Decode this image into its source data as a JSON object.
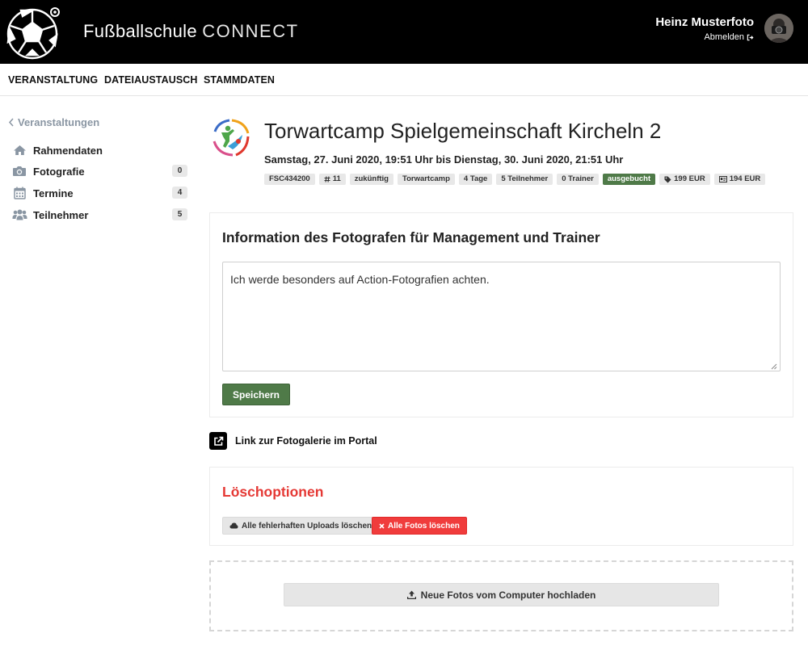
{
  "header": {
    "app_name": "Fußballschule",
    "app_product": "CONNECT",
    "logo_icon": "football-icon",
    "user_name": "Heinz Musterfoto",
    "logout_label": "Abmelden",
    "logout_icon": "sign-out-icon",
    "avatar_icon": "avatar"
  },
  "nav": {
    "items": [
      {
        "label": "VERANSTALTUNG"
      },
      {
        "label": "DATEIAUSTAUSCH"
      },
      {
        "label": "STAMMDATEN"
      }
    ]
  },
  "sidebar": {
    "back_label": "Veranstaltungen",
    "items": [
      {
        "label": "Rahmendaten",
        "icon": "home-icon",
        "badge": null
      },
      {
        "label": "Fotografie",
        "icon": "camera-icon",
        "badge": "0"
      },
      {
        "label": "Termine",
        "icon": "calendar-icon",
        "badge": "4"
      },
      {
        "label": "Teilnehmer",
        "icon": "users-icon",
        "badge": "5"
      }
    ]
  },
  "event": {
    "title": "Torwartcamp Spielgemeinschaft Kircheln 2",
    "date_range": "Samstag, 27. Juni 2020, 19:51 Uhr bis Dienstag, 30. Juni 2020, 21:51 Uhr",
    "tags": [
      {
        "label": "FSC434200",
        "icon": null,
        "variant": "default"
      },
      {
        "label": "11",
        "icon": "hash-icon",
        "variant": "default"
      },
      {
        "label": "zukünftig",
        "icon": null,
        "variant": "default"
      },
      {
        "label": "Torwartcamp",
        "icon": null,
        "variant": "default"
      },
      {
        "label": "4 Tage",
        "icon": null,
        "variant": "default"
      },
      {
        "label": "5 Teilnehmer",
        "icon": null,
        "variant": "default"
      },
      {
        "label": "0 Trainer",
        "icon": null,
        "variant": "default"
      },
      {
        "label": "ausgebucht",
        "icon": null,
        "variant": "success"
      },
      {
        "label": "199 EUR",
        "icon": "tag-icon",
        "variant": "default"
      },
      {
        "label": "194 EUR",
        "icon": "id-card-icon",
        "variant": "default"
      }
    ]
  },
  "photographer_info": {
    "heading": "Information des Fotografen für Management und Trainer",
    "text": "Ich werde besonders auf Action-Fotografien achten.",
    "save_label": "Speichern"
  },
  "gallery_link": {
    "label": "Link zur Fotogalerie im Portal",
    "icon": "external-link-icon"
  },
  "delete_options": {
    "heading": "Löschoptionen",
    "delete_failed_label": "Alle fehlerhaften Uploads löschen",
    "delete_failed_icon": "cloud-icon",
    "delete_all_label": "Alle Fotos löschen",
    "delete_all_icon": "close-icon"
  },
  "upload": {
    "label": "Neue Fotos vom Computer hochladen",
    "icon": "upload-icon"
  },
  "colors": {
    "header_bg": "#000000",
    "success": "#4f7a48",
    "danger": "#f03c3c",
    "sidebar_back": "#8a96a3"
  }
}
